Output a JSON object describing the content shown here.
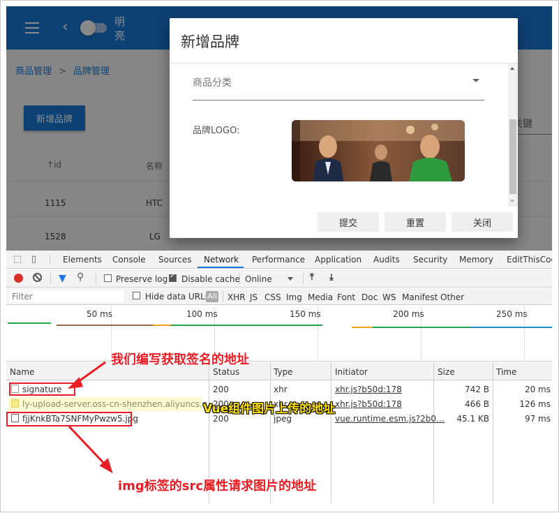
{
  "app": {
    "theme_label": "明亮",
    "breadcrumb": {
      "first": "商品管理",
      "separator": ">",
      "second": "品牌管理"
    },
    "add_brand_button": "新增品牌",
    "search_hint": "入关键",
    "table": {
      "headers": {
        "id": "id",
        "name": "名称"
      },
      "rows": [
        {
          "id": "1115",
          "name": "HTC"
        },
        {
          "id": "1528",
          "name": "LG"
        }
      ]
    }
  },
  "dialog": {
    "title": "新增品牌",
    "category_label": "商品分类",
    "logo_label": "品牌LOGO:",
    "buttons": {
      "submit": "提交",
      "reset": "重置",
      "close": "关闭"
    }
  },
  "devtools": {
    "tabs": [
      "Elements",
      "Console",
      "Sources",
      "Network",
      "Performance",
      "Application",
      "Audits",
      "Security",
      "Memory",
      "EditThisCoo"
    ],
    "active_tab": "Network",
    "toolbar": {
      "preserve_log": "Preserve log",
      "disable_cache": "Disable cache",
      "throttle": "Online"
    },
    "filter": {
      "placeholder": "Filter",
      "hide_data_urls": "Hide data URLs",
      "all": "All",
      "types": [
        "XHR",
        "JS",
        "CSS",
        "Img",
        "Media",
        "Font",
        "Doc",
        "WS",
        "Manifest",
        "Other"
      ]
    },
    "overview_ticks": [
      "50 ms",
      "100 ms",
      "150 ms",
      "200 ms",
      "250 ms"
    ],
    "columns": {
      "name": "Name",
      "status": "Status",
      "type": "Type",
      "initiator": "Initiator",
      "size": "Size",
      "time": "Time"
    },
    "requests": [
      {
        "name": "signature",
        "status": "200",
        "type": "xhr",
        "initiator": "xhr.js?b50d:178",
        "size": "742 B",
        "time": "20 ms"
      },
      {
        "name": "ly-upload-server.oss-cn-shenzhen.aliyuncs.com",
        "status": "200",
        "type": "xhr",
        "initiator": "xhr.js?b50d:178",
        "size": "466 B",
        "time": "126 ms"
      },
      {
        "name": "fjjKnkBTa7SNFMyPwzw5.jpg",
        "status": "200",
        "type": "jpeg",
        "initiator": "vue.runtime.esm.js?2b0…",
        "size": "45.1 KB",
        "time": "97 ms"
      }
    ]
  },
  "annotations": {
    "signature_note": "我们编写获取签名的地址",
    "upload_note": "Vue组件图片上传的地址",
    "img_note": "img标签的src属性请求图片的地址"
  },
  "colors": {
    "primary": "#1976d2",
    "annotation_red": "#ea1c24",
    "annotation_yellow": "#ffe000",
    "record_red": "#d93025"
  }
}
